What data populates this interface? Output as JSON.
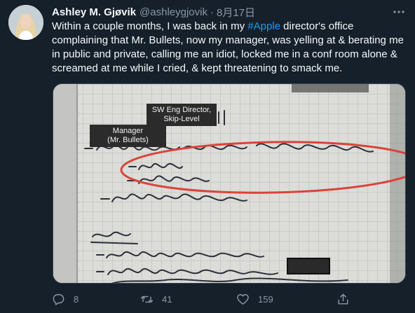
{
  "tweet": {
    "display_name": "Ashley M. Gjøvik",
    "handle": "@ashleygjovik",
    "separator": "·",
    "date": "8月17日",
    "text_before": "Within a couple months, I was back in my ",
    "hashtag": "#Apple",
    "text_after": " director's office complaining that Mr. Bullets, now my manager, was yelling at & berating me in public and private, calling me an idiot, locked me in a conf room alone & screamed at me while I cried, & kept threatening to smack me.",
    "more_icon": "more-horizontal-icon"
  },
  "media": {
    "label_director_line1": "SW Eng Director,",
    "label_director_line2": "Skip-Level",
    "label_manager_line1": "Manager",
    "label_manager_line2": "(Mr. Bullets)",
    "handwriting": {
      "one_on_one": "1:1",
      "line1": "-yelling, berating, condemning",
      "line2": "-public",
      "line3": "-private",
      "line4": "-getting worse",
      "topics": "topics",
      "line5": "-because I'm your Mngr",
      "line6": "-if you want to be a"
    },
    "circle_color": "#d9443a"
  },
  "actions": {
    "reply_count": "8",
    "retweet_count": "41",
    "like_count": "159",
    "share_label": ""
  },
  "colors": {
    "background": "#15202b",
    "text": "#f7f9f9",
    "secondary": "#8b98a5",
    "accent": "#1d9bf0"
  }
}
